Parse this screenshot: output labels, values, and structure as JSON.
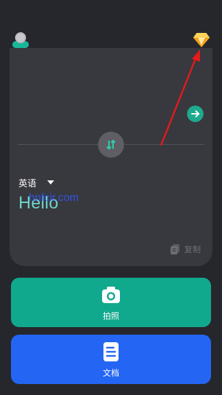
{
  "header": {
    "avatar_icon": "user-avatar-icon",
    "premium_icon": "diamond-icon"
  },
  "translator": {
    "go_icon": "arrow-right-icon",
    "swap_icon": "swap-arrows-icon",
    "target_language": "英语",
    "result": "Hello",
    "copy_label": "复制",
    "watermark": "hnfcir.com"
  },
  "actions": {
    "photo_label": "拍照",
    "document_label": "文档"
  },
  "colors": {
    "background": "#26272c",
    "card": "#38383f",
    "accent_green": "#11a98d",
    "accent_blue": "#2465f4",
    "result_text": "#6fd6c9",
    "annotation_arrow": "#e21b1b"
  }
}
